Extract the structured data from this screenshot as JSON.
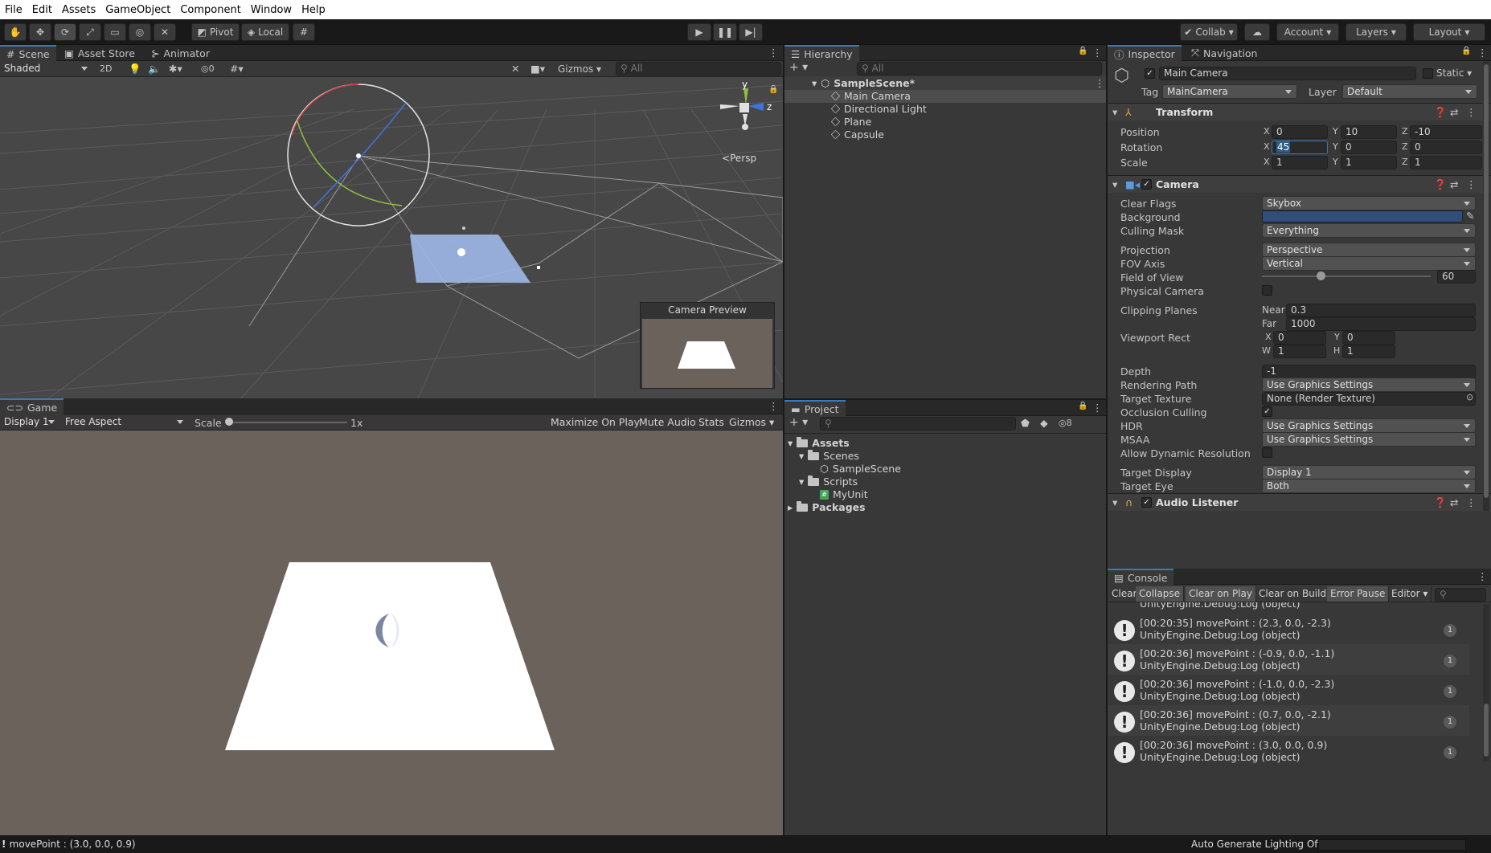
{
  "menu": [
    "File",
    "Edit",
    "Assets",
    "GameObject",
    "Component",
    "Window",
    "Help"
  ],
  "toolbar": {
    "pivot": "Pivot",
    "local": "Local",
    "collab": "Collab",
    "account": "Account",
    "layers": "Layers",
    "layout": "Layout"
  },
  "scene": {
    "tabs": [
      "Scene",
      "Asset Store",
      "Animator"
    ],
    "shading": "Shaded",
    "mode2d": "2D",
    "hidden_count": "0",
    "gizmos": "Gizmos",
    "search_placeholder": "All",
    "persp": "Persp",
    "axis_y": "y",
    "axis_z": "z",
    "camera_preview": "Camera Preview"
  },
  "game": {
    "tab": "Game",
    "display": "Display 1",
    "aspect": "Free Aspect",
    "scale_label": "Scale",
    "scale_value": "1x",
    "buttons": [
      "Maximize On Play",
      "Mute Audio",
      "Stats",
      "Gizmos"
    ]
  },
  "hierarchy": {
    "title": "Hierarchy",
    "search_placeholder": "All",
    "scene": "SampleScene*",
    "items": [
      "Main Camera",
      "Directional Light",
      "Plane",
      "Capsule"
    ]
  },
  "project": {
    "title": "Project",
    "hidden_count": "8",
    "assets": "Assets",
    "scenes": "Scenes",
    "sample_scene": "SampleScene",
    "scripts": "Scripts",
    "myunit": "MyUnit",
    "packages": "Packages"
  },
  "inspector": {
    "tabs": [
      "Inspector",
      "Navigation"
    ],
    "object_name": "Main Camera",
    "static": "Static",
    "tag_label": "Tag",
    "tag": "MainCamera",
    "layer_label": "Layer",
    "layer": "Default",
    "transform": {
      "title": "Transform",
      "position_label": "Position",
      "rotation_label": "Rotation",
      "scale_label": "Scale",
      "position": [
        "0",
        "10",
        "-10"
      ],
      "rotation": [
        "45",
        "0",
        "0"
      ],
      "scale": [
        "1",
        "1",
        "1"
      ],
      "axes": [
        "X",
        "Y",
        "Z"
      ]
    },
    "camera": {
      "title": "Camera",
      "clear_flags_label": "Clear Flags",
      "clear_flags": "Skybox",
      "background_label": "Background",
      "background_color": "#314d79",
      "culling_mask_label": "Culling Mask",
      "culling_mask": "Everything",
      "projection_label": "Projection",
      "projection": "Perspective",
      "fov_axis_label": "FOV Axis",
      "fov_axis": "Vertical",
      "fov_label": "Field of View",
      "fov": "60",
      "fov_slider_fraction": 0.348,
      "physical_label": "Physical Camera",
      "clipping_label": "Clipping Planes",
      "near_label": "Near",
      "near": "0.3",
      "far_label": "Far",
      "far": "1000",
      "viewport_label": "Viewport Rect",
      "vx_label": "X",
      "vx": "0",
      "vy_label": "Y",
      "vy": "0",
      "vw_label": "W",
      "vw": "1",
      "vh_label": "H",
      "vh": "1",
      "depth_label": "Depth",
      "depth": "-1",
      "rendering_path_label": "Rendering Path",
      "rendering_path": "Use Graphics Settings",
      "target_texture_label": "Target Texture",
      "target_texture": "None (Render Texture)",
      "occlusion_label": "Occlusion Culling",
      "hdr_label": "HDR",
      "hdr": "Use Graphics Settings",
      "msaa_label": "MSAA",
      "msaa": "Use Graphics Settings",
      "dynres_label": "Allow Dynamic Resolution",
      "target_display_label": "Target Display",
      "target_display": "Display 1",
      "target_eye_label": "Target Eye",
      "target_eye": "Both"
    },
    "audio_listener": "Audio Listener"
  },
  "console": {
    "title": "Console",
    "buttons": [
      "Clear",
      "Collapse",
      "Clear on Play",
      "Clear on Build",
      "Error Pause",
      "Editor"
    ],
    "partial_line": "UnityEngine.Debug:Log (object)",
    "logs": [
      {
        "l1": "[00:20:35] movePoint : (2.3, 0.0, -2.3)",
        "l2": "UnityEngine.Debug:Log (object)",
        "count": "1"
      },
      {
        "l1": "[00:20:36] movePoint : (-0.9, 0.0, -1.1)",
        "l2": "UnityEngine.Debug:Log (object)",
        "count": "1"
      },
      {
        "l1": "[00:20:36] movePoint : (-1.0, 0.0, -2.3)",
        "l2": "UnityEngine.Debug:Log (object)",
        "count": "1"
      },
      {
        "l1": "[00:20:36] movePoint : (0.7, 0.0, -2.1)",
        "l2": "UnityEngine.Debug:Log (object)",
        "count": "1"
      },
      {
        "l1": "[00:20:36] movePoint : (3.0, 0.0, 0.9)",
        "l2": "UnityEngine.Debug:Log (object)",
        "count": "1"
      }
    ]
  },
  "statusbar": {
    "message": "movePoint : (3.0, 0.0, 0.9)",
    "lighting": "Auto Generate Lighting Off"
  },
  "colors": {
    "accent": "#3a79bb",
    "selection": "#2c5d87",
    "game_bg": "#6b625c"
  }
}
